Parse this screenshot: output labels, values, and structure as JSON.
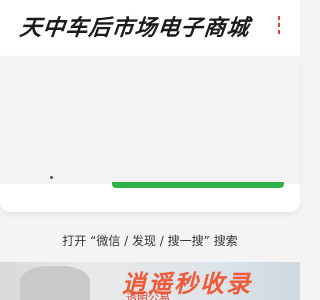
{
  "header": {
    "logo_text": "天中车后市场电子商城"
  },
  "menu": {
    "icon": "menu-icon",
    "color": "#d9452e"
  },
  "qr_card": {
    "button_color": "#2fb24a"
  },
  "instruction": {
    "text": "打开 “微信 / 发现 / 搜一搜” 搜索"
  },
  "banner": {
    "title": "逍遥秒收录",
    "subtitle": "透明公易"
  }
}
